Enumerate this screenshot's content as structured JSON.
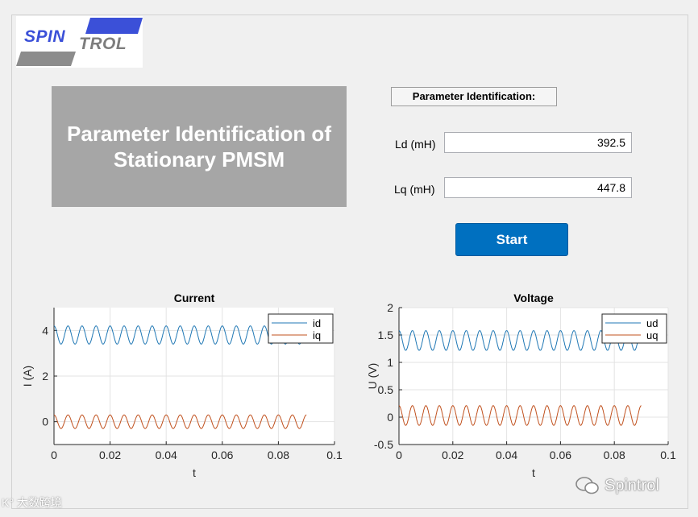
{
  "logo": {
    "part1": "SPIN",
    "part2": "TROL",
    "colors": {
      "blue": "#3b50d8",
      "gray": "#8c8c8c"
    }
  },
  "title": {
    "text": "Parameter Identification of\nStationary PMSM"
  },
  "identification": {
    "section_label": "Parameter Identification:",
    "ld": {
      "label": "Ld (mH)",
      "value": "392.5"
    },
    "lq": {
      "label": "Lq (mH)",
      "value": "447.8"
    },
    "start_label": "Start"
  },
  "watermark": {
    "text": "Spintrol"
  },
  "corner_mark": "K° 大数跨境",
  "chart_data": [
    {
      "type": "line",
      "title": "Current",
      "xlabel": "t",
      "ylabel": "I (A)",
      "xlim": [
        0,
        0.1
      ],
      "ylim": [
        -1,
        5
      ],
      "xticks": [
        "0",
        "0.02",
        "0.04",
        "0.06",
        "0.08",
        "0.1"
      ],
      "yticks": [
        "0",
        "2",
        "4"
      ],
      "grid": true,
      "legend_position": "top-right",
      "series": [
        {
          "name": "id",
          "color": "#1f77b4",
          "offset": 3.8,
          "amplitude": 0.4,
          "frequency": 200,
          "x_range": [
            0,
            0.09
          ]
        },
        {
          "name": "iq",
          "color": "#c0501d",
          "offset": 0.0,
          "amplitude": 0.3,
          "frequency": 200,
          "x_range": [
            0,
            0.09
          ]
        }
      ]
    },
    {
      "type": "line",
      "title": "Voltage",
      "xlabel": "t",
      "ylabel": "U (V)",
      "xlim": [
        0,
        0.1
      ],
      "ylim": [
        -0.5,
        2
      ],
      "xticks": [
        "0",
        "0.02",
        "0.04",
        "0.06",
        "0.08",
        "0.1"
      ],
      "yticks": [
        "-0.5",
        "0",
        "0.5",
        "1",
        "1.5",
        "2"
      ],
      "grid": true,
      "legend_position": "top-right",
      "series": [
        {
          "name": "ud",
          "color": "#1f77b4",
          "offset": 1.4,
          "amplitude": 0.18,
          "frequency": 200,
          "x_range": [
            0,
            0.09
          ]
        },
        {
          "name": "uq",
          "color": "#c0501d",
          "offset": 0.03,
          "amplitude": 0.18,
          "frequency": 200,
          "x_range": [
            0,
            0.09
          ]
        }
      ]
    }
  ]
}
